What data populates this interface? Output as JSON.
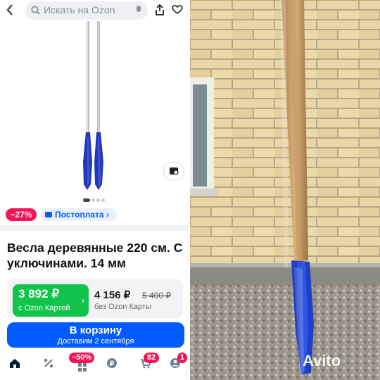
{
  "header": {
    "back_icon": "chevron-left-icon",
    "search_placeholder": "Искать на Ozon",
    "share_icon": "share-icon",
    "favorite_icon": "heart-icon"
  },
  "gallery": {
    "total_images": 4,
    "current_index": 1
  },
  "badges": {
    "discount": "−27%",
    "postpay": "Постоплата"
  },
  "product": {
    "title": "Весла деревянные 220 см. С уключинами. 14 мм"
  },
  "price": {
    "card_price": "3 892 ₽",
    "card_label": "с Ozon Картой",
    "regular_price": "4 156 ₽",
    "old_price": "5 400 ₽",
    "regular_label": "без Ozon Карты"
  },
  "cart": {
    "label": "В корзину",
    "delivery": "Доставим 2 сентября"
  },
  "nav": {
    "sale_badge": "−50%",
    "cart_badge": "82",
    "profile_badge": "1"
  },
  "watermark": "Avito",
  "colors": {
    "ozon_blue": "#005bff",
    "green": "#10c44c",
    "pink": "#f91155"
  }
}
